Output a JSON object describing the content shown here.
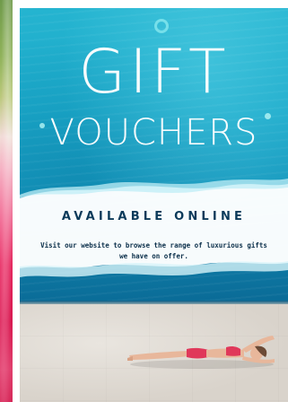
{
  "poster": {
    "title_line1": "GIFT",
    "title_line2": "VOUCHERS",
    "headline": "AVAILABLE ONLINE",
    "body": "Visit our website to browse the range of luxurious gifts we have on offer."
  },
  "colors": {
    "pool": "#1aa8c9",
    "headline_text": "#0b3a5a",
    "wave": "#ffffff",
    "deck": "#dcd6cf",
    "swimsuit": "#e0385a"
  },
  "icons": {
    "bubble": "bubble-icon",
    "person": "sunbathing-woman-illustration"
  }
}
